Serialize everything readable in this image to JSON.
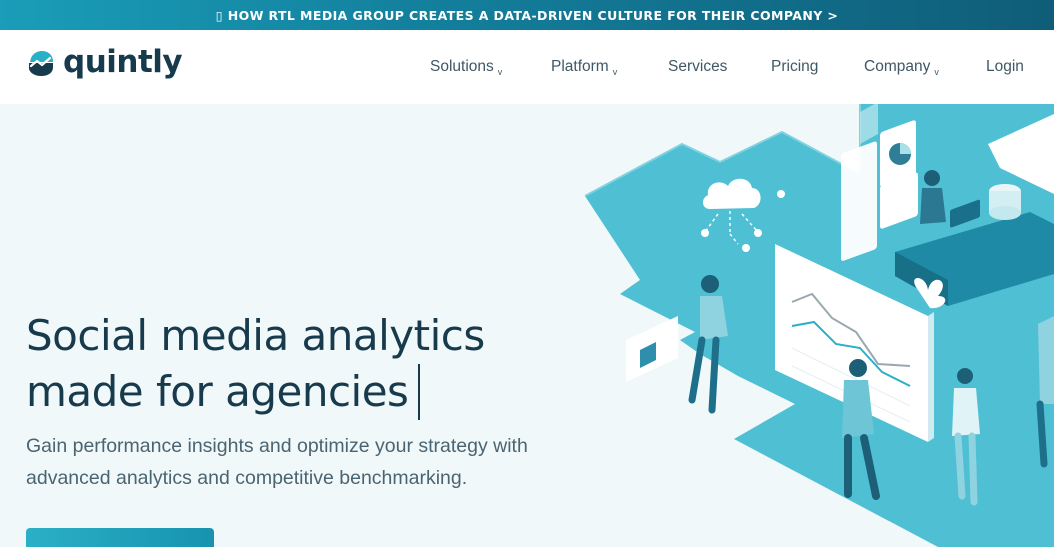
{
  "announcement": {
    "icon": "megaphone-icon",
    "text": "▯ HOW RTL MEDIA GROUP CREATES A DATA-DRIVEN CULTURE FOR THEIR COMPANY >"
  },
  "header": {
    "logo": {
      "icon": "quintly-logo-mark",
      "text": "quintly"
    },
    "nav": [
      {
        "label": "Solutions",
        "has_dropdown": true,
        "chevron": "v"
      },
      {
        "label": "Platform",
        "has_dropdown": true,
        "chevron": "v"
      },
      {
        "label": "Services",
        "has_dropdown": false
      },
      {
        "label": "Pricing",
        "has_dropdown": false
      },
      {
        "label": "Company",
        "has_dropdown": true,
        "chevron": "v"
      },
      {
        "label": "Login",
        "has_dropdown": false
      }
    ]
  },
  "hero": {
    "headline_line1": "Social media analytics",
    "headline_line2": "made for agencies",
    "subtext": "Gain performance insights and optimize your strategy with advanced analytics and competitive benchmarking.",
    "cta_label": ""
  },
  "colors": {
    "brand_teal": "#2ab0c6",
    "brand_dark": "#173a4d",
    "topbar_start": "#1a9db8",
    "topbar_end": "#0f5d78",
    "hero_bg": "#f1f8f9",
    "illustration_teal": "#4fbfd3"
  }
}
